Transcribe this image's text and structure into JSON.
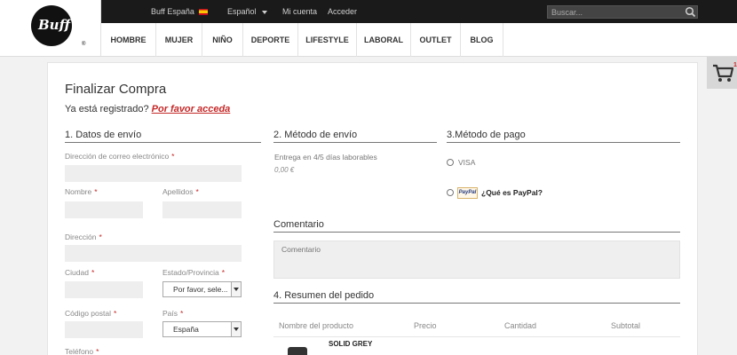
{
  "header": {
    "logo_text": "Buff",
    "logo_reg": "®",
    "topbar": {
      "store_label": "Buff España",
      "language": "Español",
      "account": "Mi cuenta",
      "login": "Acceder"
    },
    "search": {
      "placeholder": "Buscar..."
    },
    "nav": [
      "HOMBRE",
      "MUJER",
      "NIÑO",
      "DEPORTE",
      "LIFESTYLE",
      "LABORAL",
      "OUTLET",
      "BLOG"
    ]
  },
  "cart": {
    "count": "1",
    "icon": "cart-icon"
  },
  "checkout": {
    "title": "Finalizar Compra",
    "registered_text": "Ya está registrado?",
    "registered_link": "Por favor acceda",
    "shipping_data": {
      "title": "1. Datos de envío",
      "email_label": "Dirección de correo electrónico",
      "name_label": "Nombre",
      "surname_label": "Apellidos",
      "address_label": "Dirección",
      "city_label": "Ciudad",
      "state_label": "Estado/Provincia",
      "state_value": "Por favor, sele...",
      "postcode_label": "Código postal",
      "country_label": "País",
      "country_value": "España",
      "phone_label": "Teléfono",
      "required_mark": "*"
    },
    "shipping_method": {
      "title": "2. Método de envío",
      "option": "Entrega en 4/5 días laborables",
      "price": "0,00 €"
    },
    "payment": {
      "title": "3.Método de pago",
      "visa": "VISA",
      "paypal_logo": "PayPal",
      "paypal_link": "¿Qué es PayPal?"
    },
    "comment": {
      "title": "Comentario",
      "placeholder": "Comentario"
    },
    "summary": {
      "title": "4. Resumen del pedido",
      "columns": [
        "Nombre del producto",
        "Precio",
        "Cantidad",
        "Subtotal"
      ],
      "items": [
        {
          "name": "SOLID GREY"
        }
      ]
    }
  },
  "colors": {
    "topbar": "#1a1a1a",
    "accent": "#c62828",
    "background": "#f2f2f2"
  }
}
